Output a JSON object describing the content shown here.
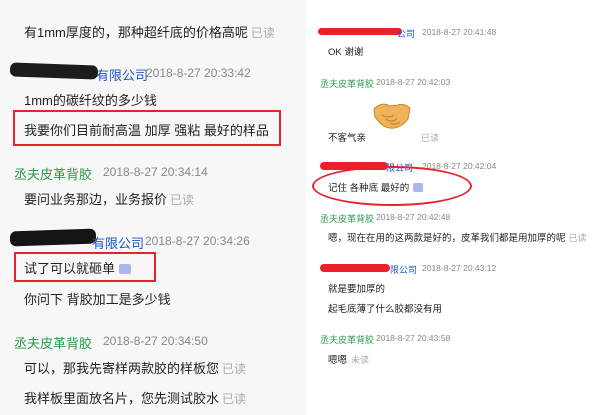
{
  "colors": {
    "company_name": "#1a56c4",
    "self_name": "#2a9a4a",
    "annotation": "#e8212b",
    "timestamp": "#888888",
    "read_status": "#aaaaaa"
  },
  "left": {
    "messages": [
      {
        "text": "有1mm厚度的，那种超纤底的价格高呢",
        "status": "已读"
      },
      {
        "sender": "有限公司",
        "time": "2018-8-27 20:33:42",
        "lines": [
          "1mm的碳纤纹的多少钱",
          "我要你们目前耐高温  加厚  强粘  最好的样品"
        ]
      },
      {
        "sender": "丞夫皮革背胶",
        "time": "2018-8-27 20:34:14",
        "lines": [
          "要问业务那边，业务报价"
        ],
        "status": "已读"
      },
      {
        "sender": "有限公司",
        "time": "2018-8-27 20:34:26",
        "lines": [
          "试了可以就砸单",
          "你问下  背胶加工是多少钱"
        ],
        "icon": "more-icon"
      },
      {
        "sender": "丞夫皮革背胶",
        "time": "2018-8-27 20:34:50",
        "lines": [
          "可以，那我先寄样两款胶的样板您",
          "我样板里面放名片，您先测试胶水"
        ],
        "statuses": [
          "已读",
          "已读"
        ]
      }
    ]
  },
  "right": {
    "messages": [
      {
        "sender": "公司",
        "time": "2018-8-27 20:41:48",
        "text": "OK  谢谢"
      },
      {
        "sender": "丞夫皮革背胶",
        "time": "2018-8-27 20:42:03",
        "emoji": "handshake-icon",
        "text": "不客气亲",
        "status": "已读"
      },
      {
        "sender": "限公司",
        "time": "2018-8-27 20:42:04",
        "text": "记住  各种底  最好的",
        "icon": "more-icon"
      },
      {
        "sender": "丞夫皮革背胶",
        "time": "2018-8-27 20:42:48",
        "text": "嗯，现在在用的这两款是好的，皮革我们都是用加厚的呢",
        "status": "已读"
      },
      {
        "sender": "限公司",
        "time": "2018-8-27 20:43:12",
        "lines": [
          "就是要加厚的",
          "起毛底薄了什么胶都没有用"
        ]
      },
      {
        "sender": "丞夫皮革背胶",
        "time": "2018-8-27 20:43:58",
        "text": "嗯嗯",
        "status": "未读"
      }
    ]
  }
}
